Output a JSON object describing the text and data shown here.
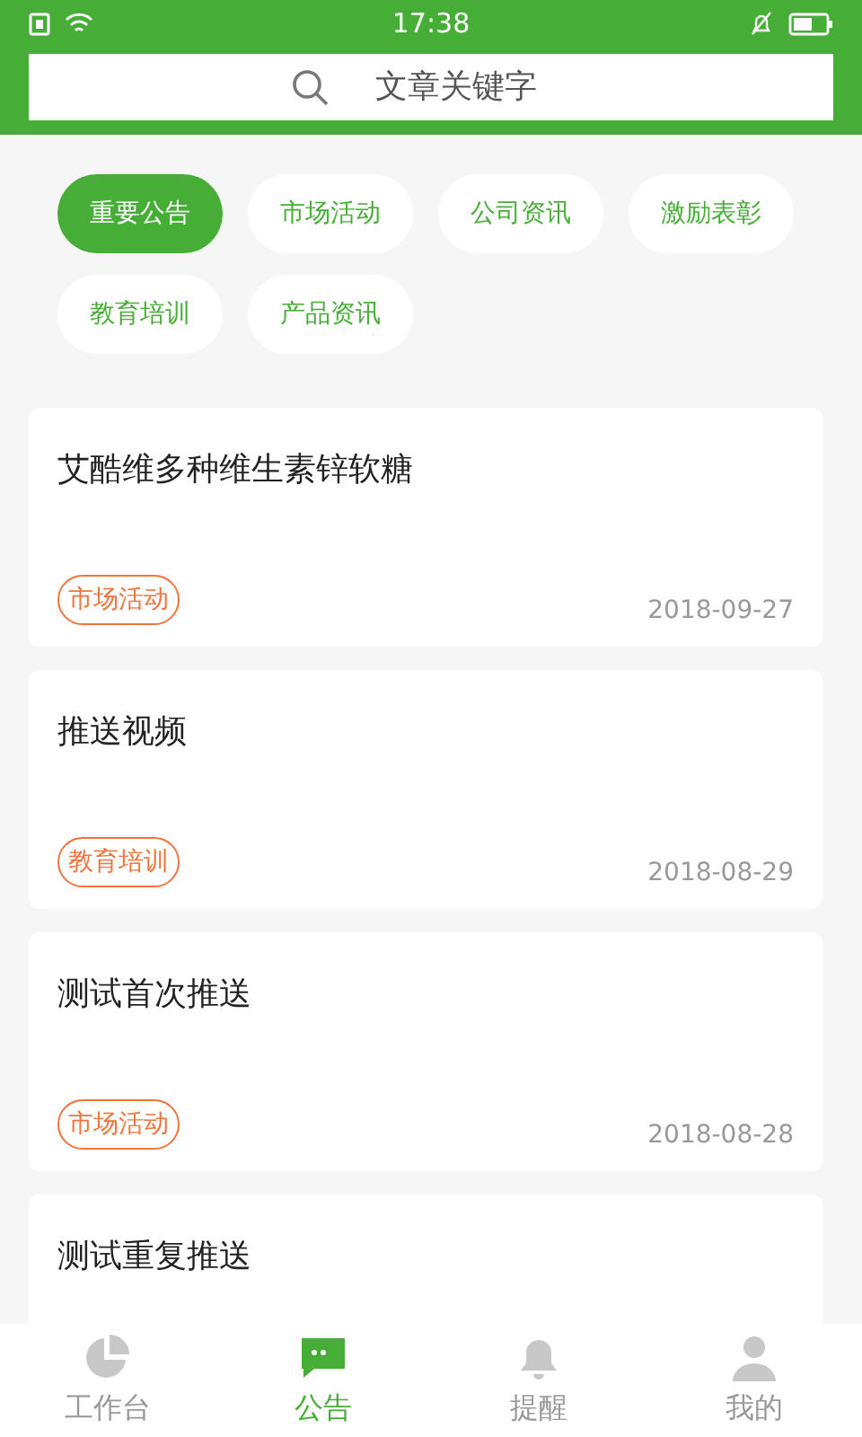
{
  "status_bar": {
    "time": "17:38"
  },
  "search": {
    "placeholder": "文章关键字"
  },
  "categories": [
    {
      "label": "重要公告",
      "selected": true
    },
    {
      "label": "市场活动",
      "selected": false
    },
    {
      "label": "公司资讯",
      "selected": false
    },
    {
      "label": "激励表彰",
      "selected": false
    },
    {
      "label": "教育培训",
      "selected": false
    },
    {
      "label": "产品资讯",
      "selected": false
    }
  ],
  "articles": [
    {
      "title": "艾酷维多种维生素锌软糖",
      "tag": "市场活动",
      "date": "2018-09-27"
    },
    {
      "title": "推送视频",
      "tag": "教育培训",
      "date": "2018-08-29"
    },
    {
      "title": "测试首次推送",
      "tag": "市场活动",
      "date": "2018-08-28"
    },
    {
      "title": "测试重复推送"
    }
  ],
  "tab_bar": [
    {
      "label": "工作台",
      "kind": "chart",
      "selected": false
    },
    {
      "label": "公告",
      "kind": "chat",
      "selected": true
    },
    {
      "label": "提醒",
      "kind": "bell",
      "selected": false
    },
    {
      "label": "我的",
      "kind": "person",
      "selected": false
    }
  ]
}
